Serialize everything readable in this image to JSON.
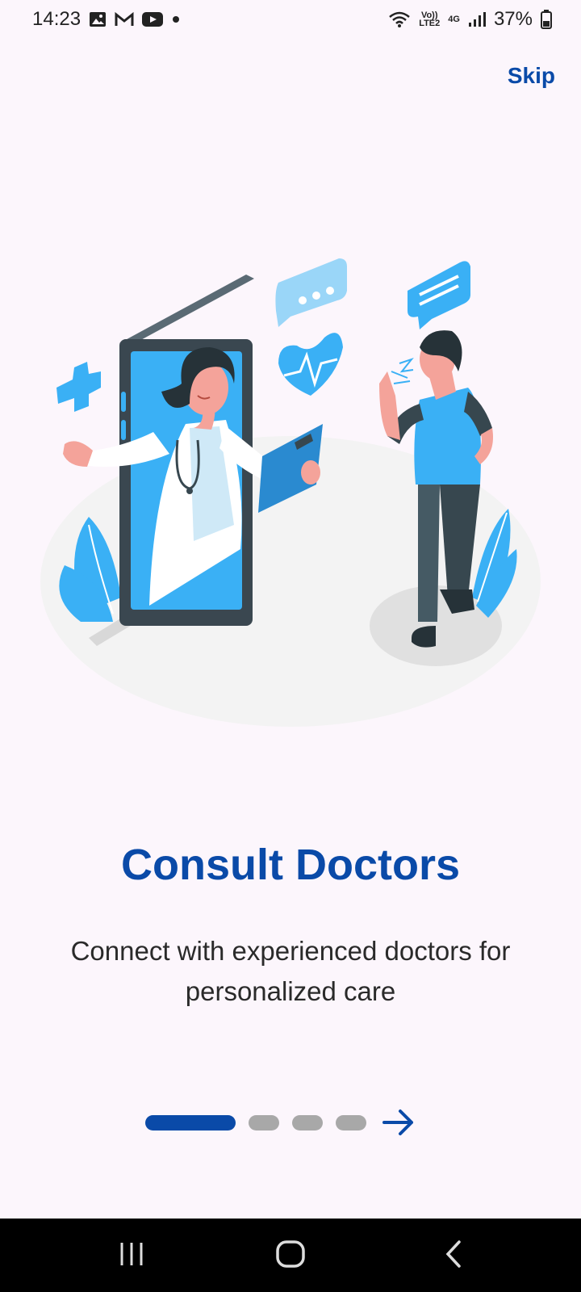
{
  "status_bar": {
    "time": "14:23",
    "left_icons": [
      "gallery-icon",
      "gmail-icon",
      "youtube-icon",
      "notification-dot-icon"
    ],
    "volte_top": "Vo))",
    "volte_bottom": "LTE2",
    "network": "4G",
    "battery": "37%"
  },
  "header": {
    "skip_label": "Skip"
  },
  "onboarding": {
    "illustration": "doctor-video-consultation-illustration",
    "title": "Consult Doctors",
    "subtitle_line1": "Connect with experienced doctors for",
    "subtitle_line2": "personalized care"
  },
  "pager": {
    "total": 4,
    "current": 1,
    "next_icon": "arrow-right-icon"
  },
  "colors": {
    "primary": "#0a4aa8",
    "background": "#fcf6fc",
    "accent": "#3ab0f5",
    "inactive_dot": "#a8a8a8"
  },
  "nav_bar": {
    "buttons": [
      "recent-apps-icon",
      "home-icon",
      "back-icon"
    ]
  }
}
